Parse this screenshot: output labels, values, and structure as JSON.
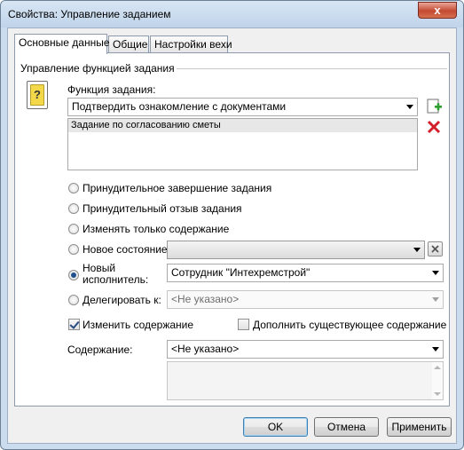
{
  "window": {
    "title": "Свойства: Управление заданием",
    "close_symbol": "x"
  },
  "tabs": [
    {
      "label": "Основные данные",
      "active": true
    },
    {
      "label": "Общие",
      "active": false
    },
    {
      "label": "Настройки вехи",
      "active": false
    }
  ],
  "group": {
    "title": "Управление функцией задания"
  },
  "function": {
    "label": "Функция задания:",
    "value": "Подтвердить ознакомление с документами",
    "list_items": [
      "Задание по согласованию сметы"
    ],
    "icon_glyph": "?"
  },
  "options": {
    "force_complete": "Принудительное завершение задания",
    "force_revoke": "Принудительный отзыв задания",
    "change_content_only": "Изменять только содержание",
    "new_state": "Новое состояние:",
    "new_executor_line1": "Новый",
    "new_executor_line2": "исполнитель:",
    "delegate": "Делегировать к:"
  },
  "fields": {
    "new_state_value": "",
    "new_executor_value": "Сотрудник \"Интехремстрой\"",
    "delegate_value": "<Не указано>"
  },
  "checkboxes": {
    "change_content": {
      "label": "Изменить содержание",
      "checked": true
    },
    "append_content": {
      "label": "Дополнить существующее содержание",
      "checked": false
    }
  },
  "content": {
    "label": "Содержание:",
    "value": "<Не указано>"
  },
  "buttons": {
    "ok": "OK",
    "cancel": "Отмена",
    "apply": "Применить"
  },
  "colors": {
    "accent": "#1f4f8d",
    "window_frame": "#cbdcee",
    "close_red": "#c44a33"
  }
}
